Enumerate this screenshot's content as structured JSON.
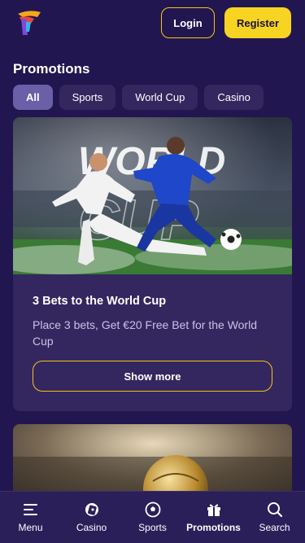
{
  "header": {
    "login_label": "Login",
    "register_label": "Register"
  },
  "page": {
    "title": "Promotions"
  },
  "filters": [
    {
      "label": "All",
      "active": true
    },
    {
      "label": "Sports",
      "active": false
    },
    {
      "label": "World Cup",
      "active": false
    },
    {
      "label": "Casino",
      "active": false
    }
  ],
  "promotion": {
    "image_overlay": "WORLD CUP",
    "title": "3 Bets to the World Cup",
    "description": "Place 3 bets, Get €20 Free Bet for the World Cup",
    "cta_label": "Show more"
  },
  "bottom_nav": [
    {
      "label": "Menu",
      "icon": "menu-icon"
    },
    {
      "label": "Casino",
      "icon": "casino-chip-icon"
    },
    {
      "label": "Sports",
      "icon": "football-icon"
    },
    {
      "label": "Promotions",
      "icon": "gift-icon",
      "active": true
    },
    {
      "label": "Search",
      "icon": "search-icon"
    }
  ],
  "colors": {
    "background": "#221650",
    "card": "#34275f",
    "accent": "#f7d421",
    "chip_active": "#6b5fa8"
  }
}
